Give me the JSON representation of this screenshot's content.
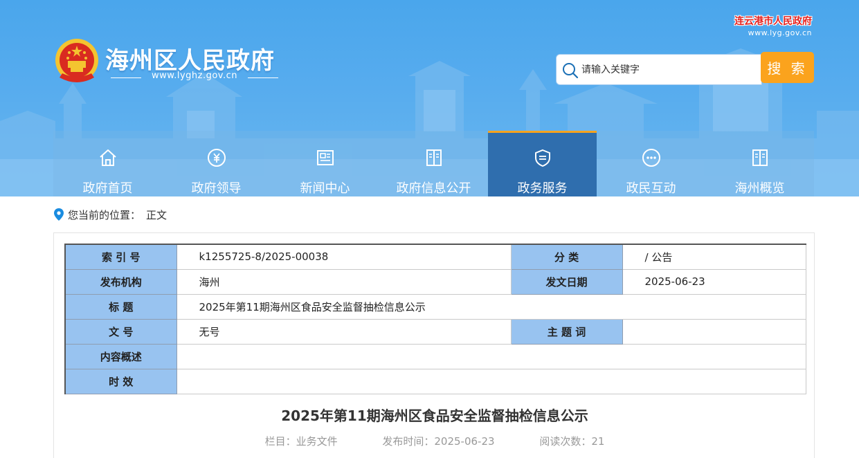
{
  "header": {
    "site_title": "海州区人民政府",
    "site_url": "www.lyghz.gov.cn",
    "city_name": "连云港市人民政府",
    "city_url": "www.lyg.gov.cn",
    "emblem_icon": "national-emblem-icon"
  },
  "search": {
    "placeholder": "请输入关键字",
    "button_label": "搜 索",
    "icon": "search-icon"
  },
  "nav": {
    "items": [
      {
        "label": "政府首页",
        "icon": "home-icon",
        "active": false
      },
      {
        "label": "政府领导",
        "icon": "yuan-circle-icon",
        "active": false
      },
      {
        "label": "新闻中心",
        "icon": "newspaper-icon",
        "active": false
      },
      {
        "label": "政府信息公开",
        "icon": "book-icon",
        "active": false
      },
      {
        "label": "政务服务",
        "icon": "shield-icon",
        "active": true
      },
      {
        "label": "政民互动",
        "icon": "chat-dots-icon",
        "active": false
      },
      {
        "label": "海州概览",
        "icon": "book-icon",
        "active": false
      }
    ]
  },
  "breadcrumb": {
    "prefix": "您当前的位置：",
    "current": "正文"
  },
  "meta": {
    "index_no_label": "索 引 号",
    "index_no": "k1255725-8/2025-00038",
    "category_label": "分 类",
    "category": "/ 公告",
    "publisher_label": "发布机构",
    "publisher": "海州",
    "date_label": "发文日期",
    "date": "2025-06-23",
    "title_label": "标 题",
    "title": "2025年第11期海州区食品安全监督抽检信息公示",
    "doc_no_label": "文 号",
    "doc_no": "无号",
    "keywords_label": "主 题 词",
    "keywords": "",
    "summary_label": "内容概述",
    "summary": "",
    "validity_label": "时 效",
    "validity": ""
  },
  "article": {
    "title": "2025年第11期海州区食品安全监督抽检信息公示",
    "column": "栏目：业务文件",
    "publish_time": "发布时间：2025-06-23",
    "views": "阅读次数：21"
  },
  "colors": {
    "header_blue": "#57acee",
    "nav_active": "#2f6eae",
    "accent_orange": "#fba31d",
    "table_key_bg": "#98c3f0",
    "city_red": "#e5231f"
  }
}
